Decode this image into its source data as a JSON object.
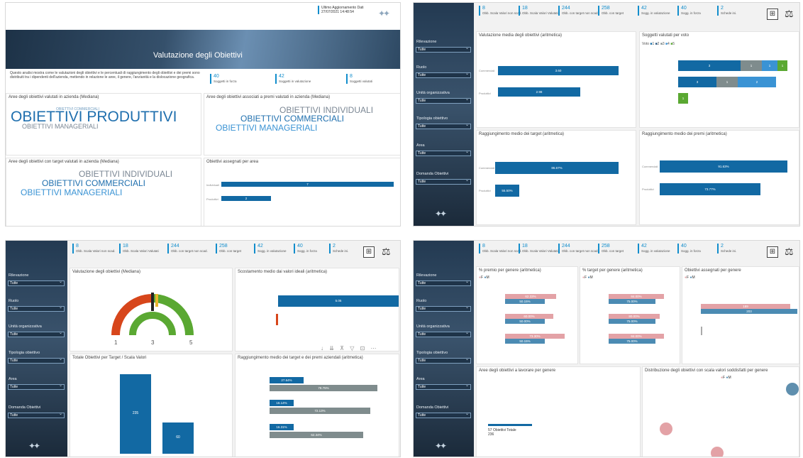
{
  "q1": {
    "update_label": "Ultimo Aggiornamento Dati",
    "update_value": "27/07/2021 14:48:54",
    "title": "Valutazione degli Obiettivi",
    "description": "Questo analisi mostra come le valutazioni degli obiettivi e le percentuali di raggiungimento degli obiettivi e dei premi sono distribuiti tra i dipendenti dell'azienda, mettendo in relazione le aree, il genere, l'anzianità e la dislocazione geografica.",
    "kpis": [
      {
        "value": "40",
        "label": "Soggetti in forza"
      },
      {
        "value": "42",
        "label": "Soggetti in valutazione"
      },
      {
        "value": "8",
        "label": "Soggetti valutati"
      }
    ],
    "card1_title": "Aree degli obiettivi valutati in azienda (Mediana)",
    "card1_words": [
      "OBIETTIVI COMMERCIALI",
      "OBIETTIVI PRODUTTIVI",
      "OBIETTIVI MANAGERIALI"
    ],
    "card2_title": "Aree degli obiettivi associati a premi valutati in azienda (Mediana)",
    "card2_words": [
      "OBIETTIVI INDIVIDUALI",
      "OBIETTIVI COMMERCIALI",
      "OBIETTIVI MANAGERIALI"
    ],
    "card3_title": "Aree degli obiettivi con target valutati in azienda (Mediana)",
    "card3_words": [
      "OBIETTIVI INDIVIDUALI",
      "OBIETTIVI COMMERCIALI",
      "OBIETTIVI MANAGERIALI"
    ],
    "card4_title": "Obiettivi assegnati per area",
    "card4_bars": [
      {
        "label": "Individuali",
        "value": 7
      },
      {
        "label": "Produttivi",
        "value": 2
      }
    ]
  },
  "filters": {
    "labels": [
      "Rilevazione",
      "Ruolo",
      "Unità organizzativa",
      "Tipologia obiettivo",
      "Area",
      "Domanda Obiettivi"
    ],
    "value": "Tutte"
  },
  "kpibar": [
    {
      "value": "8",
      "label": "Obb. Scala Valori non scad."
    },
    {
      "value": "18",
      "label": "Obb. Scala Valori Valutati"
    },
    {
      "value": "244",
      "label": "Obb. con target non scad."
    },
    {
      "value": "258",
      "label": "Obb. con target"
    },
    {
      "value": "42",
      "label": "Sogg. in valutazione"
    },
    {
      "value": "40",
      "label": "Sogg. in forza"
    },
    {
      "value": "2",
      "label": "Schede ini."
    }
  ],
  "q2": {
    "c1_title": "Valutazione media degli obiettivi (aritmetica)",
    "c1_bars": [
      {
        "label": "Commerciali",
        "value": "3.60"
      },
      {
        "label": "Produttivi",
        "value": "2.98"
      }
    ],
    "c2_title": "Soggetti valutati per voto",
    "c2_legend_title": "Voto",
    "c2_legend": [
      "1",
      "2",
      "3",
      "4",
      "5"
    ],
    "c2_rows": [
      [
        "3",
        "1",
        "1",
        "1"
      ],
      [
        "3",
        "1",
        "2"
      ],
      [
        "1"
      ]
    ],
    "c3_title": "Raggiungimento medio dei target (aritmetica)",
    "c3_bars": [
      {
        "label": "Commerciali",
        "value": "86.67%"
      },
      {
        "label": "Produttivi",
        "value": "55.50%"
      }
    ],
    "c4_title": "Raggiungimento medio dei premi (aritmetica)",
    "c4_bars": [
      {
        "label": "Commerciali",
        "value": "91.63%"
      },
      {
        "label": "Produttivi",
        "value": "73.77%"
      }
    ]
  },
  "q3": {
    "c1_title": "Valutazione degli obiettivi (Mediana)",
    "gauge_min": "1",
    "gauge_value": "3",
    "gauge_max": "5",
    "c2_title": "Scostamento medio dai valori ideali (aritmetica)",
    "c2_value": "5.05",
    "c3_title": "Totale Obiettivi per Target / Scala Valori",
    "c3_bars": [
      {
        "label": "Target",
        "value": "235"
      },
      {
        "label": "Scala Valori",
        "value": "60"
      }
    ],
    "c4_title": "Raggiungimento medio dei target e dei premi aziendali (aritmetica)",
    "c4_rows": [
      {
        "a": "27.64%",
        "b": "78.75%"
      },
      {
        "a": "16.14%",
        "b": "72.13%"
      },
      {
        "a": "16.31%",
        "b": "62.34%"
      }
    ]
  },
  "q4": {
    "c1_title": "% premio per genere (aritmetica)",
    "c2_title": "% target per genere (aritmetica)",
    "c3_title": "Obiettivi assegnati per genere",
    "legend": [
      "F",
      "M"
    ],
    "c1_rows": [
      {
        "f": "62.33%",
        "m": "50.15%"
      },
      {
        "f": "60.00%",
        "m": "50.00%"
      },
      {
        "f": "73.30%",
        "m": "50.15%"
      }
    ],
    "c2_rows": [
      {
        "f": "84.00%",
        "m": "75.00%"
      },
      {
        "f": "80.00%",
        "m": "75.00%"
      },
      {
        "f": "84.00%",
        "m": "75.00%"
      }
    ],
    "c3_rows": [
      {
        "f": "189",
        "m": "203"
      }
    ],
    "c4_title": "Aree degli obiettivi a lavorare per genere",
    "c4_label": "57 Obiettivi Totale",
    "c4_value": "236",
    "c5_title": "Distribuzione degli obiettivi con scala valori soddisfatti per genere"
  },
  "colors": {
    "accent": "#118dcc",
    "bar": "#1269a3",
    "pink": "#e3a2a6",
    "gray": "#7f8c8d",
    "green": "#5aa832",
    "red": "#d7461b"
  },
  "icons": [
    "calculator-icon",
    "scale-icon",
    "brand-logo-icon"
  ]
}
